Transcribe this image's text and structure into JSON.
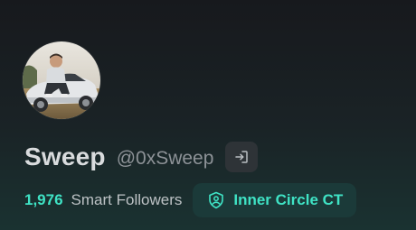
{
  "profile": {
    "display_name": "Sweep",
    "handle": "@0xSweep",
    "avatar_icon": "profile-photo",
    "login_icon": "sign-in-icon"
  },
  "stats": {
    "smart_followers_count": "1,976",
    "smart_followers_label": "Smart Followers"
  },
  "badge": {
    "label": "Inner Circle CT",
    "icon": "shield-user-icon"
  },
  "colors": {
    "accent": "#3fe3c5",
    "badge_bg": "#1b3a39",
    "name_text": "#d9dbdd",
    "handle_text": "#8d9297"
  }
}
